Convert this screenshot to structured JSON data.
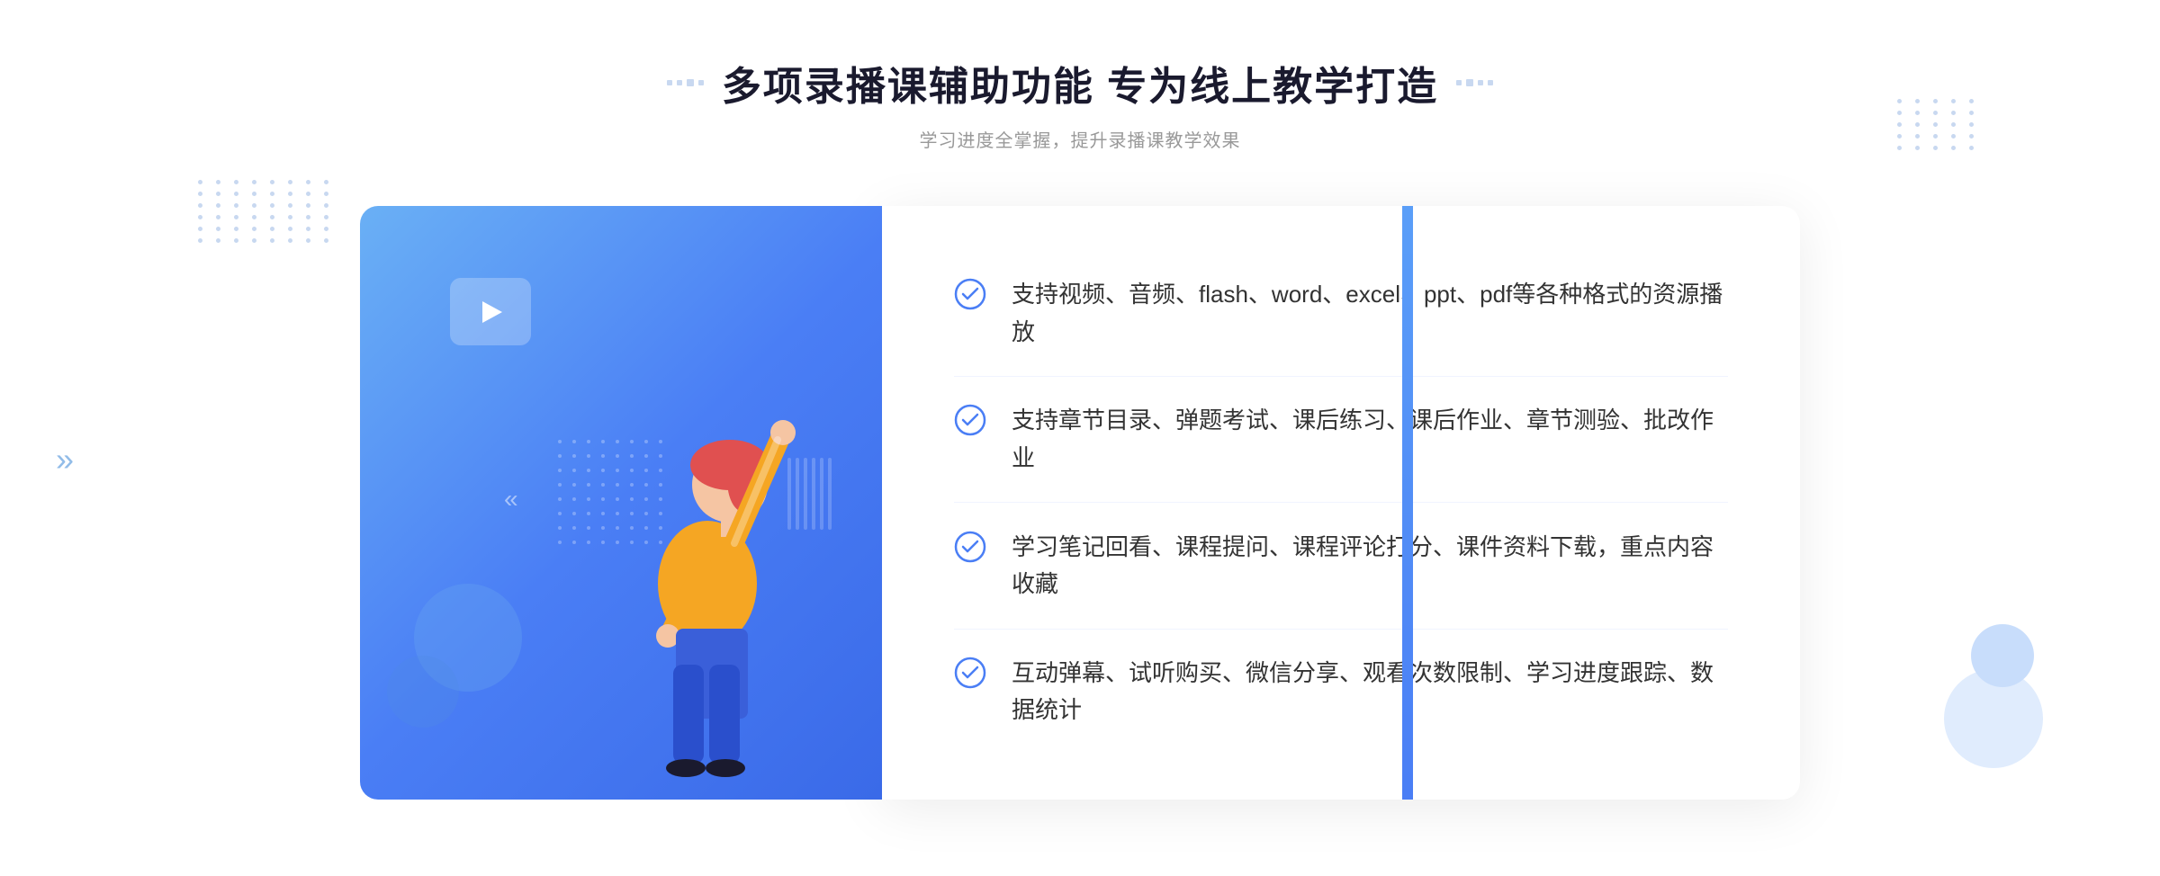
{
  "header": {
    "title": "多项录播课辅助功能 专为线上教学打造",
    "subtitle": "学习进度全掌握，提升录播课教学效果",
    "decorator_dots": 4
  },
  "features": [
    {
      "id": "feature-1",
      "text": "支持视频、音频、flash、word、excel、ppt、pdf等各种格式的资源播放"
    },
    {
      "id": "feature-2",
      "text": "支持章节目录、弹题考试、课后练习、课后作业、章节测验、批改作业"
    },
    {
      "id": "feature-3",
      "text": "学习笔记回看、课程提问、课程评论打分、课件资料下载，重点内容收藏"
    },
    {
      "id": "feature-4",
      "text": "互动弹幕、试听购买、微信分享、观看次数限制、学习进度跟踪、数据统计"
    }
  ],
  "colors": {
    "primary_blue": "#4a7ef5",
    "light_blue": "#6ab0f5",
    "text_dark": "#1a1a2e",
    "text_gray": "#999999",
    "text_body": "#333333",
    "check_color": "#4a7ef5"
  }
}
